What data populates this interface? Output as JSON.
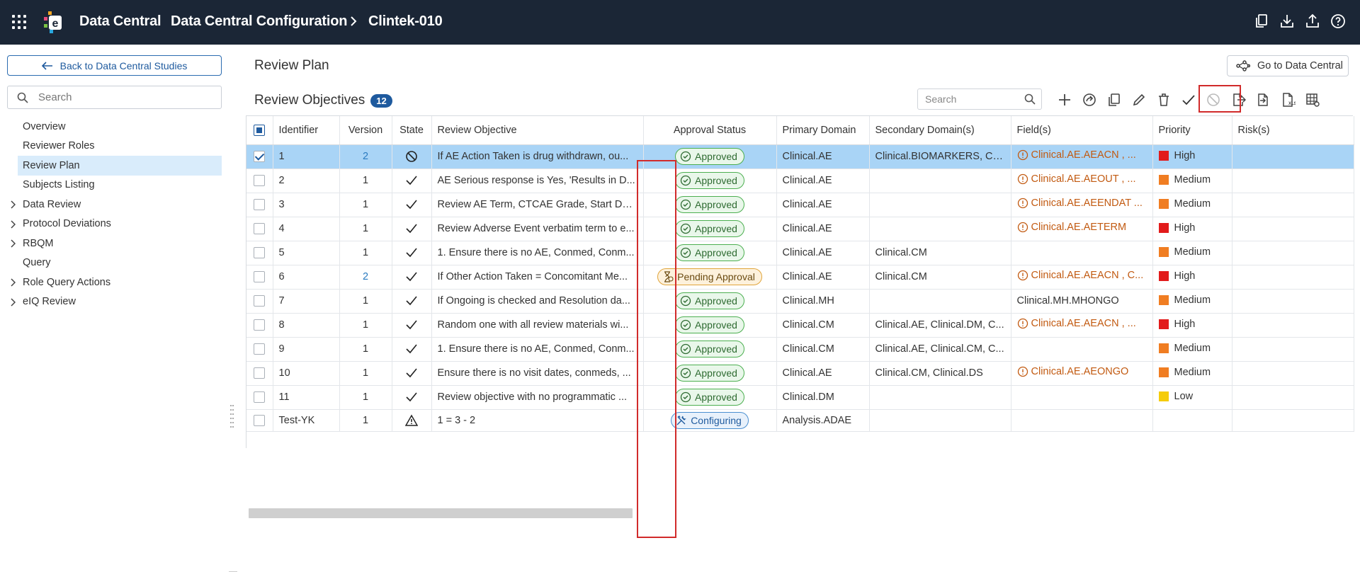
{
  "header": {
    "app_title": "Data Central",
    "breadcrumb_parent": "Data Central Configuration",
    "breadcrumb_current": "Clintek-010",
    "icons": [
      "copy-icon",
      "download-icon",
      "upload-icon",
      "help-icon"
    ]
  },
  "sidebar": {
    "back_label": "Back to Data Central Studies",
    "search_placeholder": "Search",
    "items": [
      {
        "label": "Overview",
        "expandable": false,
        "active": false
      },
      {
        "label": "Reviewer Roles",
        "expandable": false,
        "active": false
      },
      {
        "label": "Review Plan",
        "expandable": false,
        "active": true
      },
      {
        "label": "Subjects Listing",
        "expandable": false,
        "active": false
      },
      {
        "label": "Data Review",
        "expandable": true,
        "active": false
      },
      {
        "label": "Protocol Deviations",
        "expandable": true,
        "active": false
      },
      {
        "label": "RBQM",
        "expandable": true,
        "active": false
      },
      {
        "label": "Query",
        "expandable": false,
        "active": false
      },
      {
        "label": "Role Query Actions",
        "expandable": true,
        "active": false
      },
      {
        "label": "eIQ Review",
        "expandable": true,
        "active": false
      }
    ]
  },
  "main": {
    "page_title": "Review Plan",
    "goto_label": "Go to Data Central",
    "section_title": "Review Objectives",
    "count": "12",
    "search_placeholder": "Search",
    "toolbar": [
      "add-icon",
      "share-icon",
      "copy-icon",
      "edit-icon",
      "delete-icon",
      "activate-check-icon",
      "deactivate-icon",
      "export-icon",
      "import-icon",
      "xls-export-icon",
      "table-settings-icon"
    ]
  },
  "table": {
    "columns": [
      "Identifier",
      "Version",
      "State",
      "Review Objective",
      "Approval Status",
      "Primary Domain",
      "Secondary Domain(s)",
      "Field(s)",
      "Priority",
      "Risk(s)"
    ],
    "rows": [
      {
        "id": "1",
        "version": "2",
        "version_link": true,
        "state": "inactive",
        "objective": "If AE Action Taken is drug withdrawn, ou...",
        "approval": "Approved",
        "approval_type": "approved",
        "primary": "Clinical.AE",
        "secondary": "Clinical.BIOMARKERS, Cli...",
        "fields": "Clinical.AE.AEACN , ...",
        "fields_warn": true,
        "priority": "High",
        "selected": true
      },
      {
        "id": "2",
        "version": "1",
        "version_link": false,
        "state": "active",
        "objective": "AE Serious response is Yes, 'Results in D...",
        "approval": "Approved",
        "approval_type": "approved",
        "primary": "Clinical.AE",
        "secondary": "",
        "fields": "Clinical.AE.AEOUT , ...",
        "fields_warn": true,
        "priority": "Medium",
        "selected": false
      },
      {
        "id": "3",
        "version": "1",
        "version_link": false,
        "state": "active",
        "objective": "Review AE Term, CTCAE Grade, Start Dat...",
        "approval": "Approved",
        "approval_type": "approved",
        "primary": "Clinical.AE",
        "secondary": "",
        "fields": "Clinical.AE.AEENDAT ...",
        "fields_warn": true,
        "priority": "Medium",
        "selected": false
      },
      {
        "id": "4",
        "version": "1",
        "version_link": false,
        "state": "active",
        "objective": "Review Adverse Event verbatim term to e...",
        "approval": "Approved",
        "approval_type": "approved",
        "primary": "Clinical.AE",
        "secondary": "",
        "fields": "Clinical.AE.AETERM",
        "fields_warn": true,
        "priority": "High",
        "selected": false
      },
      {
        "id": "5",
        "version": "1",
        "version_link": false,
        "state": "active",
        "objective": "1. Ensure there is no AE, Conmed, Conm...",
        "approval": "Approved",
        "approval_type": "approved",
        "primary": "Clinical.AE",
        "secondary": "Clinical.CM",
        "fields": "",
        "fields_warn": false,
        "priority": "Medium",
        "selected": false
      },
      {
        "id": "6",
        "version": "2",
        "version_link": true,
        "state": "active",
        "objective": "If Other Action Taken = Concomitant Me...",
        "approval": "Pending Approval",
        "approval_type": "pending",
        "primary": "Clinical.AE",
        "secondary": "Clinical.CM",
        "fields": "Clinical.AE.AEACN , C...",
        "fields_warn": true,
        "priority": "High",
        "selected": false
      },
      {
        "id": "7",
        "version": "1",
        "version_link": false,
        "state": "active",
        "objective": "If Ongoing is checked and Resolution da...",
        "approval": "Approved",
        "approval_type": "approved",
        "primary": "Clinical.MH",
        "secondary": "",
        "fields": "Clinical.MH.MHONGO",
        "fields_warn": false,
        "priority": "Medium",
        "selected": false
      },
      {
        "id": "8",
        "version": "1",
        "version_link": false,
        "state": "active",
        "objective": "Random one with all review materials wi...",
        "approval": "Approved",
        "approval_type": "approved",
        "primary": "Clinical.CM",
        "secondary": "Clinical.AE, Clinical.DM, C...",
        "fields": "Clinical.AE.AEACN , ...",
        "fields_warn": true,
        "priority": "High",
        "selected": false
      },
      {
        "id": "9",
        "version": "1",
        "version_link": false,
        "state": "active",
        "objective": "1. Ensure there is no AE, Conmed, Conm...",
        "approval": "Approved",
        "approval_type": "approved",
        "primary": "Clinical.CM",
        "secondary": "Clinical.AE, Clinical.CM, C...",
        "fields": "",
        "fields_warn": false,
        "priority": "Medium",
        "selected": false
      },
      {
        "id": "10",
        "version": "1",
        "version_link": false,
        "state": "active",
        "objective": "Ensure there is no visit dates, conmeds, ...",
        "approval": "Approved",
        "approval_type": "approved",
        "primary": "Clinical.AE",
        "secondary": "Clinical.CM, Clinical.DS",
        "fields": "Clinical.AE.AEONGO",
        "fields_warn": true,
        "priority": "Medium",
        "selected": false
      },
      {
        "id": "11",
        "version": "1",
        "version_link": false,
        "state": "active",
        "objective": "Review objective with no programmatic ...",
        "approval": "Approved",
        "approval_type": "approved",
        "primary": "Clinical.DM",
        "secondary": "",
        "fields": "",
        "fields_warn": false,
        "priority": "Low",
        "selected": false
      },
      {
        "id": "Test-YK",
        "version": "1",
        "version_link": false,
        "state": "warning",
        "objective": "1 = 3 - 2",
        "approval": "Configuring",
        "approval_type": "config",
        "primary": "Analysis.ADAE",
        "secondary": "",
        "fields": "",
        "fields_warn": false,
        "priority": "",
        "selected": false
      }
    ]
  },
  "colors": {
    "header_bg": "#1b2636",
    "accent": "#1e5a9e",
    "selected_row": "#a9d4f6",
    "highlight_box": "#d12b2b",
    "priority_high": "#e21b1b",
    "priority_medium": "#f07d22",
    "priority_low": "#f5cc0a"
  }
}
